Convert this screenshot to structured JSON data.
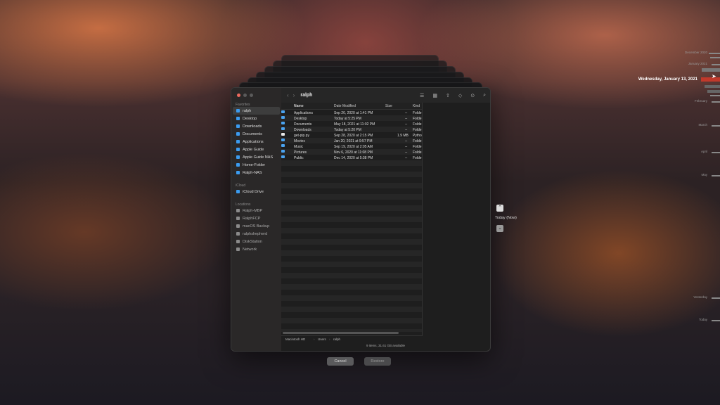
{
  "finder": {
    "title": "ralph",
    "sidebar": {
      "favorites_heading": "Favorites",
      "favorites": [
        {
          "label": "ralph",
          "selected": true
        },
        {
          "label": "Desktop"
        },
        {
          "label": "Downloads"
        },
        {
          "label": "Documents"
        },
        {
          "label": "Applications"
        },
        {
          "label": "Apple Guide"
        },
        {
          "label": "Apple Guide NAS"
        },
        {
          "label": "Home-Folder"
        },
        {
          "label": "Ralph-NAS"
        }
      ],
      "icloud_heading": "iCloud",
      "icloud": [
        {
          "label": "iCloud Drive"
        }
      ],
      "locations_heading": "Locations",
      "locations": [
        {
          "label": "Ralph-MBP"
        },
        {
          "label": "RalphFCP"
        },
        {
          "label": "macOS Backup"
        },
        {
          "label": "ralphshepherd"
        },
        {
          "label": "DiskStation"
        },
        {
          "label": "Network"
        }
      ]
    },
    "columns": {
      "name": "Name",
      "date": "Date Modified",
      "size": "Size",
      "kind": "Kind"
    },
    "rows": [
      {
        "name": "Applications",
        "date": "Sep 20, 2020 at 1:41 PM",
        "size": "--",
        "kind": "Folde"
      },
      {
        "name": "Desktop",
        "date": "Today at 5:25 PM",
        "size": "--",
        "kind": "Folde"
      },
      {
        "name": "Documents",
        "date": "May 18, 2021 at 11:02 PM",
        "size": "--",
        "kind": "Folde"
      },
      {
        "name": "Downloads",
        "date": "Today at 5:20 PM",
        "size": "--",
        "kind": "Folde"
      },
      {
        "name": "get-pip.py",
        "date": "Sep 28, 2020 at 2:15 PM",
        "size": "1.9 MB",
        "kind": "Pytho"
      },
      {
        "name": "Movies",
        "date": "Jan 20, 2021 at 9:57 PM",
        "size": "--",
        "kind": "Folde"
      },
      {
        "name": "Music",
        "date": "Sep 19, 2020 at 2:05 AM",
        "size": "--",
        "kind": "Folde"
      },
      {
        "name": "Pictures",
        "date": "Nov 6, 2020 at 11:08 PM",
        "size": "--",
        "kind": "Folde"
      },
      {
        "name": "Public",
        "date": "Dec 14, 2020 at 5:38 PM",
        "size": "--",
        "kind": "Folde"
      }
    ],
    "path": [
      "Macintosh HD",
      "Users",
      "ralph"
    ],
    "status": "9 items, 31.61 GB available"
  },
  "buttons": {
    "cancel": "Cancel",
    "restore": "Restore"
  },
  "time_machine": {
    "today_label": "Today (Now)",
    "selected_date": "Wednesday, January 13, 2021",
    "timeline": [
      "December 2020",
      "January 2021",
      "February",
      "March",
      "April",
      "May",
      "Yesterday",
      "Today"
    ]
  },
  "colors": {
    "accent": "#3b9cf0",
    "timeline_selected": "#c0392b"
  }
}
